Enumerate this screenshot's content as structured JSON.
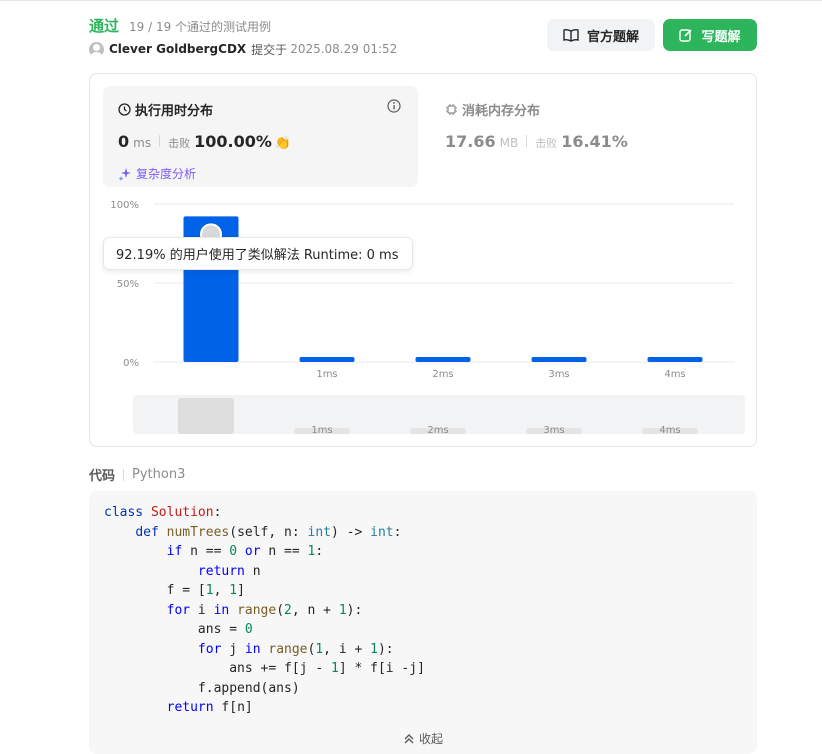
{
  "header": {
    "status": "通过",
    "testcases": "19 / 19 个通过的测试用例",
    "author": "Clever GoldbergCDX",
    "submitted_label": "提交于",
    "submitted_time": "2025.08.29 01:52",
    "solution_button": "官方题解",
    "write_button": "写题解"
  },
  "runtime": {
    "title": "执行用时分布",
    "value": "0",
    "unit": "ms",
    "beats_label": "击败",
    "beats_value": "100.00%",
    "complexity_link": "复杂度分析"
  },
  "memory": {
    "title": "消耗内存分布",
    "value": "17.66",
    "unit": "MB",
    "beats_label": "击败",
    "beats_value": "16.41%"
  },
  "tooltip": "92.19% 的用户使用了类似解法 Runtime: 0 ms",
  "chart_data": {
    "type": "bar",
    "categories": [
      "0ms",
      "1ms",
      "2ms",
      "3ms",
      "4ms"
    ],
    "x_tick_labels": [
      "",
      "1ms",
      "2ms",
      "3ms",
      "4ms"
    ],
    "values": [
      92.19,
      2,
      2,
      2,
      2
    ],
    "highlight_index": 0,
    "y_ticks": [
      "100%",
      "50%",
      "0%"
    ],
    "ylim": [
      0,
      100
    ],
    "bar_color": "#0062e6",
    "grid": true
  },
  "brush": {
    "labels": [
      "1ms",
      "2ms",
      "3ms",
      "4ms"
    ]
  },
  "code": {
    "label": "代码",
    "language": "Python3",
    "collapse_label": "收起"
  },
  "colors": {
    "accent_green": "#2db55d",
    "bar_blue": "#0062e6",
    "complexity_purple": "#7c5cf5"
  }
}
